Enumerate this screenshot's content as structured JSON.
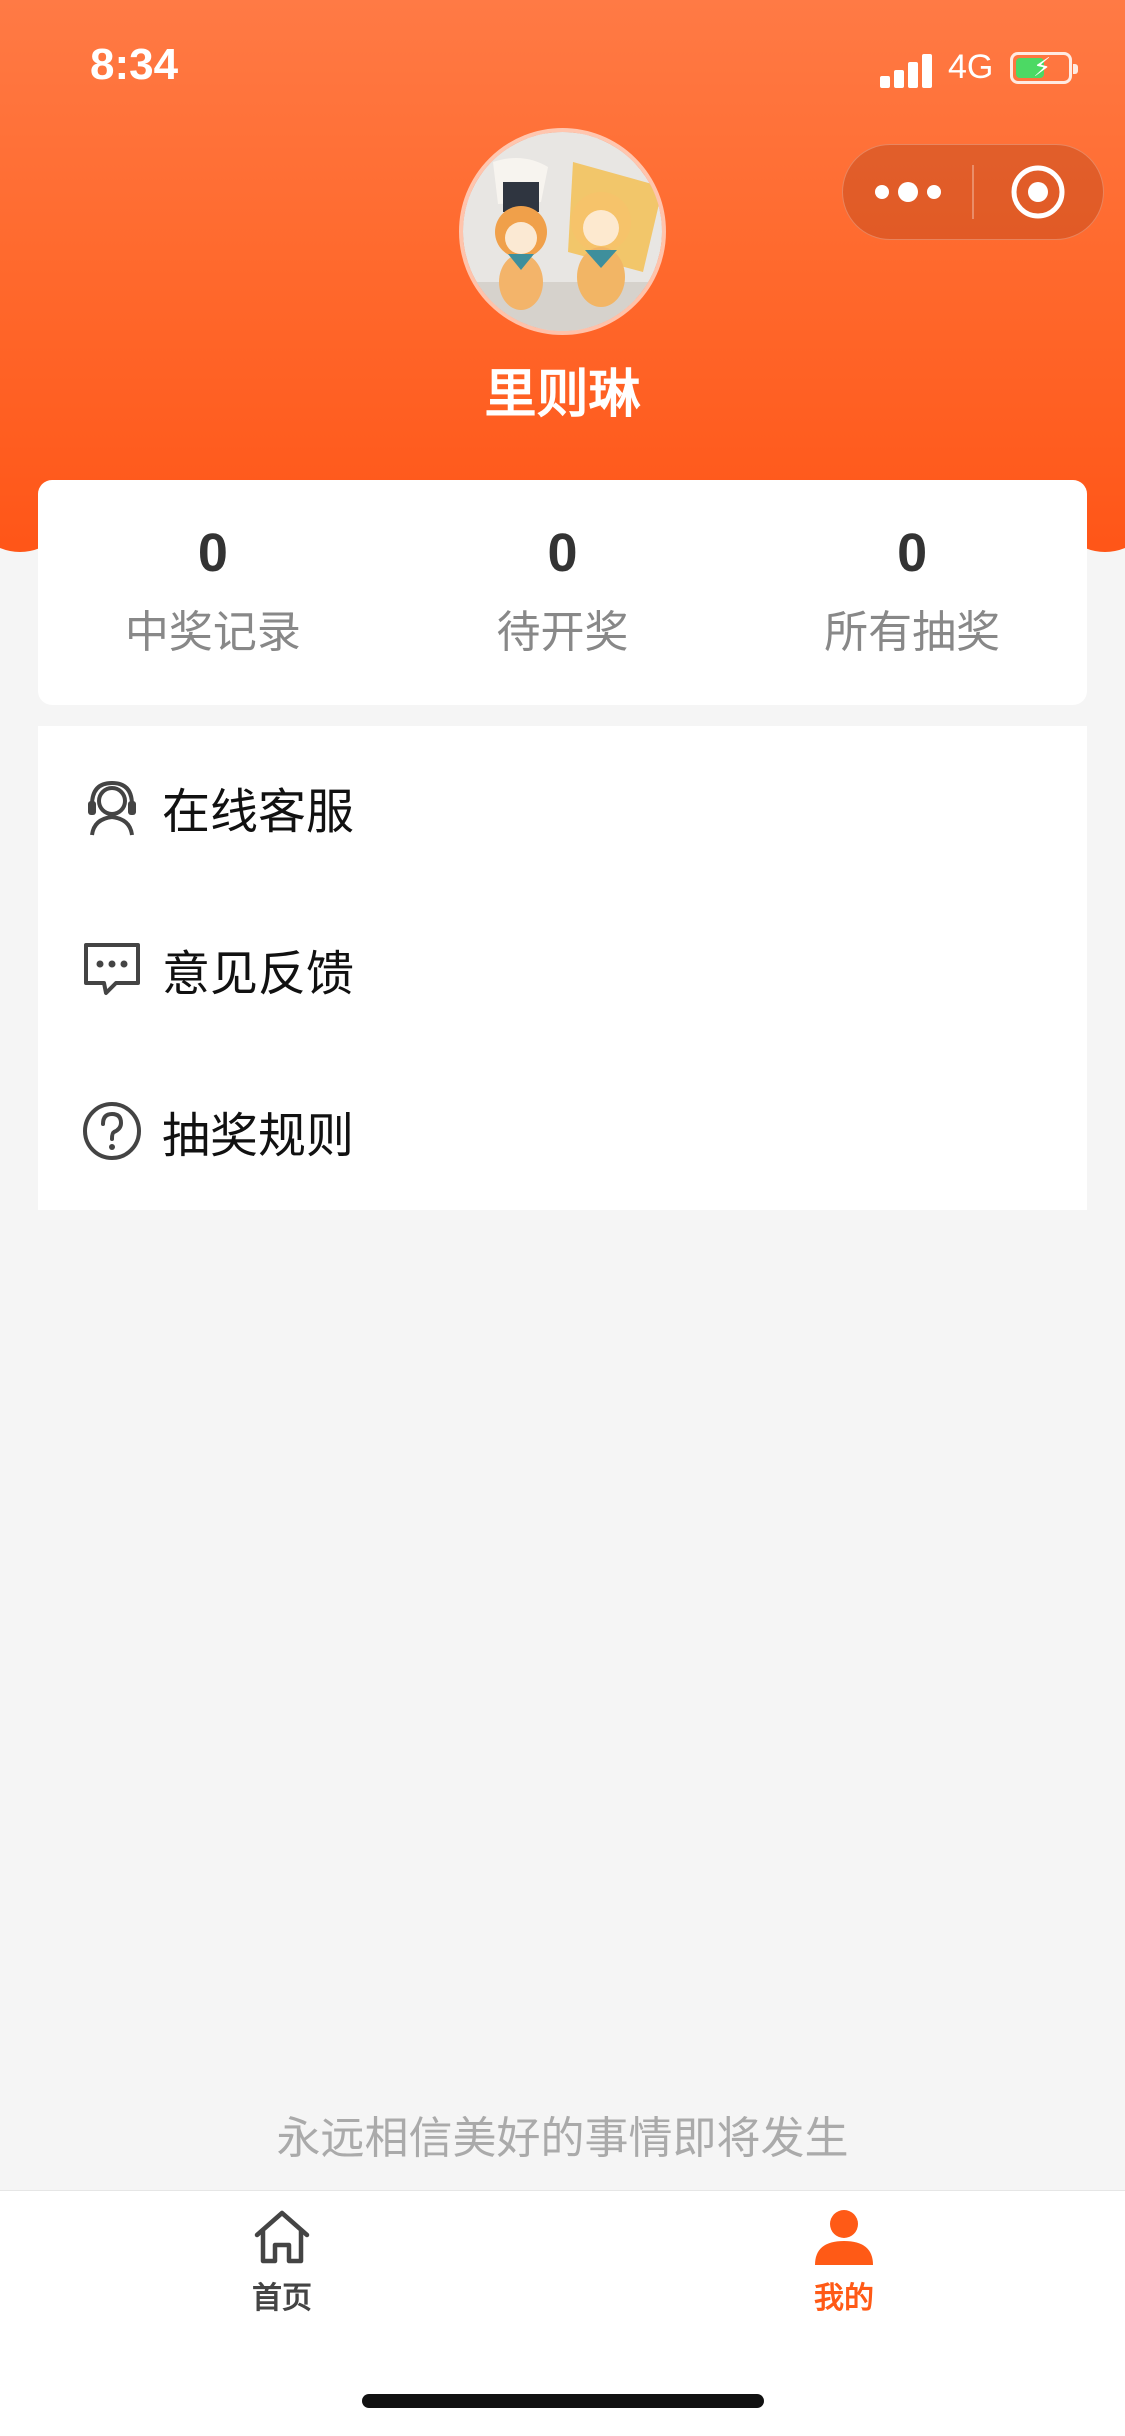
{
  "status_bar": {
    "time": "8:34",
    "network": "4G"
  },
  "profile": {
    "username": "里则琳"
  },
  "stats": [
    {
      "value": "0",
      "label": "中奖记录"
    },
    {
      "value": "0",
      "label": "待开奖"
    },
    {
      "value": "0",
      "label": "所有抽奖"
    }
  ],
  "menu": [
    {
      "label": "在线客服",
      "icon": "customer-service-icon"
    },
    {
      "label": "意见反馈",
      "icon": "feedback-icon"
    },
    {
      "label": "抽奖规则",
      "icon": "help-circle-icon"
    }
  ],
  "slogan": "永远相信美好的事情即将发生",
  "tabbar": {
    "items": [
      {
        "label": "首页",
        "icon": "home-icon"
      },
      {
        "label": "我的",
        "icon": "user-icon"
      }
    ],
    "active_color": "#ff5a16"
  },
  "colors": {
    "header_top": "#ff7a45",
    "header_bottom": "#ff5517",
    "accent": "#ff5a16"
  }
}
